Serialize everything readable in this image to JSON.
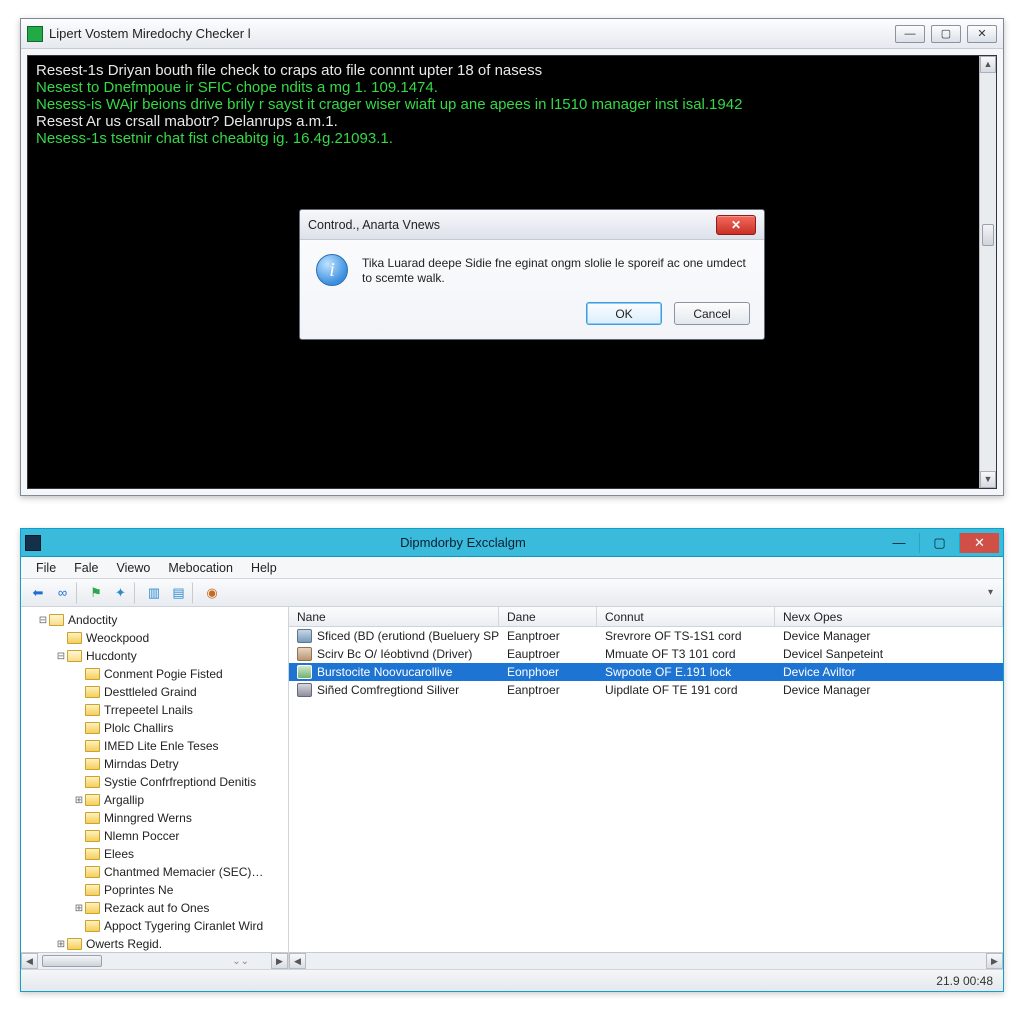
{
  "win1": {
    "title": "Lipert Vostem Miredochy Checker l",
    "console_lines": [
      {
        "cls": "white",
        "text": "Resest-1s Driyan bouth file check to craps ato file connnt upter 18 of nasess"
      },
      {
        "cls": "",
        "text": "Nesest to Dnefmpoue ir SFIC chope ndits a mg 1. 109.1474."
      },
      {
        "cls": "",
        "text": "Nesess-is WAjr beions drive brily r sayst it crager wiser wiaft up ane apees in l1510 manager inst isal.1942"
      },
      {
        "cls": "white",
        "text": "Resest Ar us crsall mabotr? Delanrups a.m.1."
      },
      {
        "cls": "",
        "text": "Nesess-1s tsetnir chat fist cheabitg ig. 16.4g.21093.1."
      }
    ],
    "min": "—",
    "max": "▢",
    "close": "✕"
  },
  "dialog": {
    "title": "Controd., Anarta Vnews",
    "message": "Tika Luarad deepe Sidie fne eginat ongm slolie le sporeif ac one umdect to scemte walk.",
    "ok": "OK",
    "cancel": "Cancel",
    "close": "✕"
  },
  "win2": {
    "title": "Dipmdorby Excclalgm",
    "menus": [
      "File",
      "Fale",
      "Viewo",
      "Mebocation",
      "Help"
    ],
    "toolbar_icons": [
      "back-icon",
      "link-icon",
      "flag-icon",
      "refresh-icon",
      "panel-icon",
      "tree-icon",
      "record-icon"
    ],
    "tree": [
      {
        "depth": 1,
        "tw": "⊟",
        "open": true,
        "label": "Andoctity"
      },
      {
        "depth": 2,
        "tw": "",
        "open": false,
        "label": "Weockpood"
      },
      {
        "depth": 2,
        "tw": "⊟",
        "open": true,
        "label": "Hucdonty"
      },
      {
        "depth": 3,
        "tw": "",
        "open": false,
        "label": "Conment Pogie Fisted"
      },
      {
        "depth": 3,
        "tw": "",
        "open": false,
        "label": "Desttleled Graind"
      },
      {
        "depth": 3,
        "tw": "",
        "open": false,
        "label": "Trrepeetel Lnails"
      },
      {
        "depth": 3,
        "tw": "",
        "open": false,
        "label": "Plolc Challirs"
      },
      {
        "depth": 3,
        "tw": "",
        "open": false,
        "label": "IMED Lite Enle Teses"
      },
      {
        "depth": 3,
        "tw": "",
        "open": false,
        "label": "Mirndas Detry"
      },
      {
        "depth": 3,
        "tw": "",
        "open": false,
        "label": "Systie Confrfreptiond Denitis"
      },
      {
        "depth": 3,
        "tw": "⊞",
        "open": false,
        "label": "Argallip"
      },
      {
        "depth": 3,
        "tw": "",
        "open": false,
        "label": "Minngred Werns"
      },
      {
        "depth": 3,
        "tw": "",
        "open": false,
        "label": "Nlemn Poccer"
      },
      {
        "depth": 3,
        "tw": "",
        "open": false,
        "label": "Elees"
      },
      {
        "depth": 3,
        "tw": "",
        "open": false,
        "label": "Chantmed Memacier (SEC)…"
      },
      {
        "depth": 3,
        "tw": "",
        "open": false,
        "label": "Poprintes Ne"
      },
      {
        "depth": 3,
        "tw": "⊞",
        "open": false,
        "label": "Rezack aut fo Ones"
      },
      {
        "depth": 3,
        "tw": "",
        "open": false,
        "label": "Appoct Tygering Ciranlet Wird"
      },
      {
        "depth": 2,
        "tw": "⊞",
        "open": false,
        "label": "Owerts Regid."
      }
    ],
    "columns": {
      "name": "Nane",
      "dane": "Dane",
      "connut": "Connut",
      "next": "Nevx Opes"
    },
    "rows": [
      {
        "icon": "i1",
        "selected": false,
        "name": "Sficed (BD (erutiond (Bueluery SPE)",
        "dane": "Eanptroer",
        "connut": "Srevrore OF TS-1S1 cord",
        "next": "Device Manager"
      },
      {
        "icon": "i2",
        "selected": false,
        "name": "Scirv Bc O/ Iéobtivnd (Driver)",
        "dane": "Eauptroer",
        "connut": "Mmuate OF T3 101 cord",
        "next": "Devicel Sanpeteint"
      },
      {
        "icon": "i3",
        "selected": true,
        "name": "Burstocite Noovucarollive",
        "dane": "Eonphoer",
        "connut": "Swpoote OF E.191 lock",
        "next": "Device Aviltor"
      },
      {
        "icon": "i4",
        "selected": false,
        "name": "Siñed Comfregtiond Siliver",
        "dane": "Eanptroer",
        "connut": "Uipdlate OF TE 191 cord",
        "next": "Device Manager"
      }
    ],
    "status": "21.9 00:48",
    "min": "—",
    "max": "▢",
    "close": "✕"
  }
}
